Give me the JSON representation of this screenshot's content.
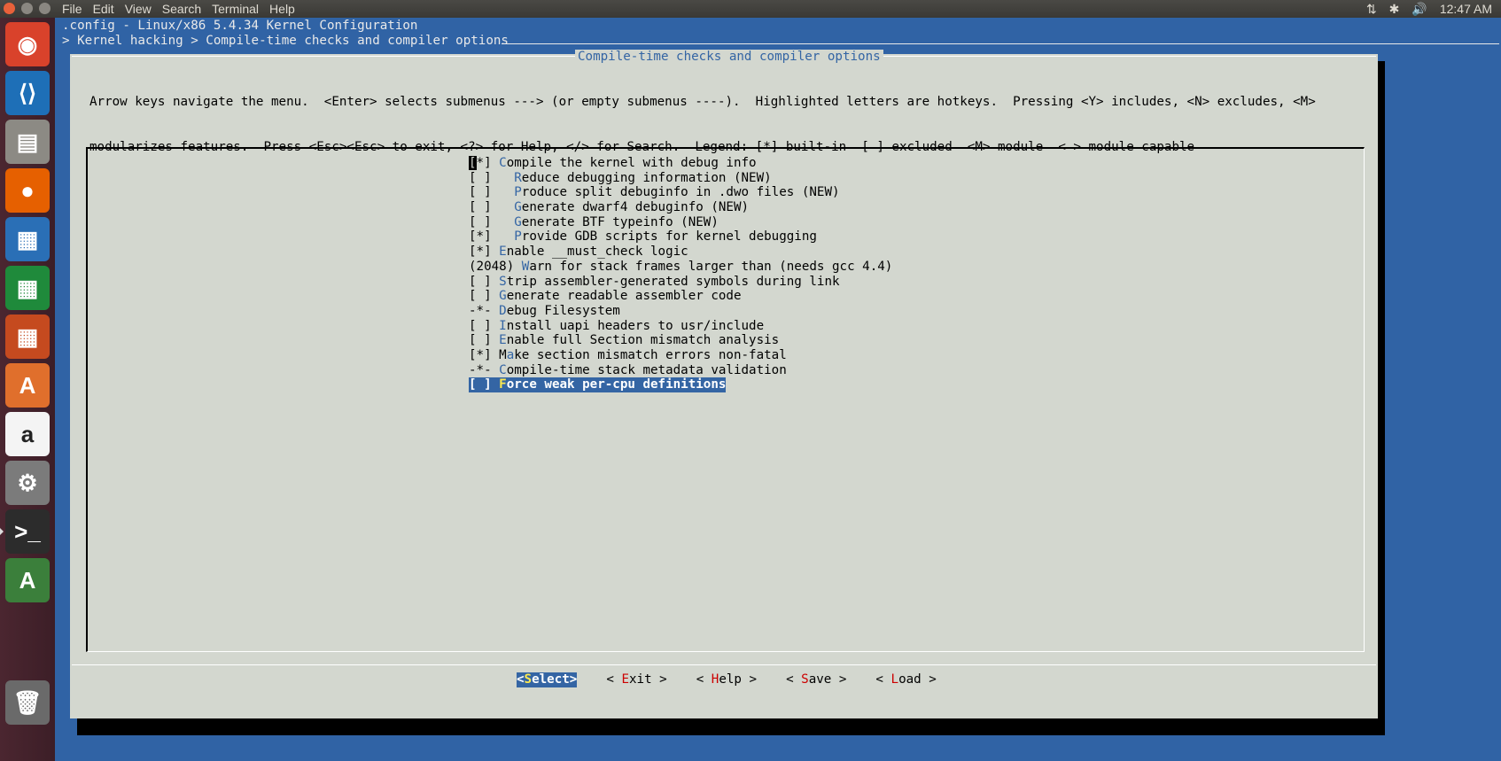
{
  "topbar": {
    "menus": [
      "File",
      "Edit",
      "View",
      "Search",
      "Terminal",
      "Help"
    ],
    "tray": {
      "network": "⇅",
      "bluetooth": "✱",
      "volume": "🔊",
      "clock": "12:47 AM"
    }
  },
  "launcher": {
    "items": [
      {
        "name": "ubuntu-dash-icon",
        "glyph": "◉",
        "bg": "#d9422b"
      },
      {
        "name": "vscode-icon",
        "glyph": "⟨⟩",
        "bg": "#1e6fb7"
      },
      {
        "name": "files-icon",
        "glyph": "▤",
        "bg": "#8c8a84"
      },
      {
        "name": "firefox-icon",
        "glyph": "●",
        "bg": "#e66000"
      },
      {
        "name": "writer-icon",
        "glyph": "▦",
        "bg": "#2a6fb6"
      },
      {
        "name": "calc-icon",
        "glyph": "▦",
        "bg": "#1f8a3b"
      },
      {
        "name": "impress-icon",
        "glyph": "▦",
        "bg": "#c54a1f"
      },
      {
        "name": "software-center-icon",
        "glyph": "A",
        "bg": "#e06f2c"
      },
      {
        "name": "amazon-icon",
        "glyph": "a",
        "bg": "#f4f4f4"
      },
      {
        "name": "system-settings-icon",
        "glyph": "⚙",
        "bg": "#7b7b7b"
      },
      {
        "name": "terminal-icon",
        "glyph": ">_",
        "bg": "#2c2c2c"
      },
      {
        "name": "software-updater-icon",
        "glyph": "A",
        "bg": "#3b7f3b"
      },
      {
        "name": "trash-icon",
        "glyph": "🗑",
        "bg": "#6a6a6a"
      }
    ]
  },
  "terminal": {
    "line1": ".config - Linux/x86 5.4.34 Kernel Configuration",
    "line2": "> Kernel hacking > Compile-time checks and compiler options"
  },
  "dialog": {
    "title": "Compile-time checks and compiler options",
    "help_line1": "Arrow keys navigate the menu.  <Enter> selects submenus ---> (or empty submenus ----).  Highlighted letters are hotkeys.  Pressing <Y> includes, <N> excludes, <M>",
    "help_line2": "modularizes features.  Press <Esc><Esc> to exit, <?> for Help, </> for Search.  Legend: [*] built-in  [ ] excluded  <M> module  < > module capable",
    "items": [
      {
        "prefix": "[*] ",
        "hot": "C",
        "rest": "ompile the kernel with debug info"
      },
      {
        "prefix": "[ ]   ",
        "hot": "R",
        "rest": "educe debugging information (NEW)"
      },
      {
        "prefix": "[ ]   ",
        "hot": "P",
        "rest": "roduce split debuginfo in .dwo files (NEW)"
      },
      {
        "prefix": "[ ]   ",
        "hot": "G",
        "rest": "enerate dwarf4 debuginfo (NEW)"
      },
      {
        "prefix": "[ ]   ",
        "hot": "G",
        "rest": "enerate BTF typeinfo (NEW)"
      },
      {
        "prefix": "[*]   ",
        "hot": "P",
        "rest": "rovide GDB scripts for kernel debugging"
      },
      {
        "prefix": "[*] ",
        "hot": "E",
        "rest": "nable __must_check logic"
      },
      {
        "prefix": "(2048) ",
        "hot": "W",
        "rest": "arn for stack frames larger than (needs gcc 4.4)"
      },
      {
        "prefix": "[ ] ",
        "hot": "S",
        "rest": "trip assembler-generated symbols during link"
      },
      {
        "prefix": "[ ] ",
        "hot": "G",
        "rest": "enerate readable assembler code"
      },
      {
        "prefix": "-*- ",
        "hot": "D",
        "rest": "ebug Filesystem"
      },
      {
        "prefix": "[ ] ",
        "hot": "I",
        "rest": "nstall uapi headers to usr/include"
      },
      {
        "prefix": "[ ] ",
        "hot": "E",
        "rest": "nable full Section mismatch analysis"
      },
      {
        "prefix": "[*] M",
        "hot": "a",
        "rest": "ke section mismatch errors non-fatal"
      },
      {
        "prefix": "-*- ",
        "hot": "C",
        "rest": "ompile-time stack metadata validation"
      },
      {
        "prefix": "[ ] ",
        "hot": "F",
        "rest": "orce weak per-cpu definitions"
      }
    ],
    "buttons": [
      {
        "pre": "<",
        "hot": "S",
        "post": "elect>",
        "name": "select-button"
      },
      {
        "pre": "< ",
        "hot": "E",
        "post": "xit >",
        "name": "exit-button"
      },
      {
        "pre": "< ",
        "hot": "H",
        "post": "elp >",
        "name": "help-button"
      },
      {
        "pre": "< ",
        "hot": "S",
        "post": "ave >",
        "name": "save-button"
      },
      {
        "pre": "< ",
        "hot": "L",
        "post": "oad >",
        "name": "load-button"
      }
    ]
  }
}
